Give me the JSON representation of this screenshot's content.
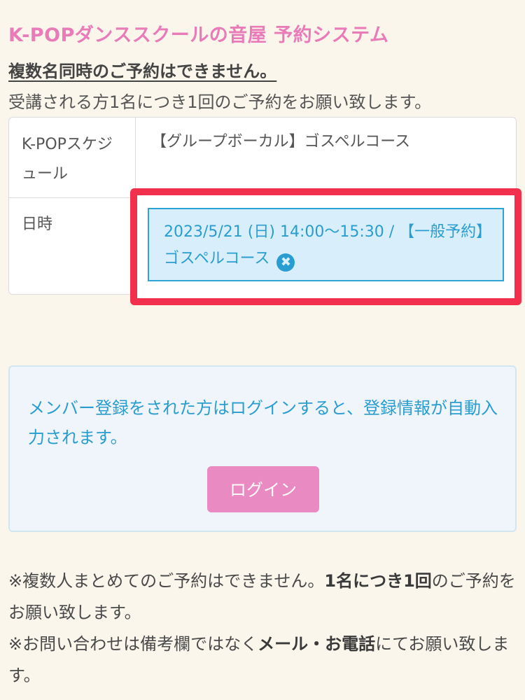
{
  "header": {
    "title": "K-POPダンススクールの音屋 予約システム",
    "notice_heading": "複数名同時のご予約はできません。",
    "notice_sub": "受講される方1名につき1回のご予約をお願い致します。"
  },
  "reservation_table": {
    "rows": [
      {
        "label": "K-POPスケジュール",
        "value": "【グループボーカル】ゴスペルコース"
      },
      {
        "label": "日時",
        "value": "2023/5/21 (日) 14:00～15:30 / 【一般予約】ゴスペルコース"
      }
    ],
    "remove_icon_glyph": "✖"
  },
  "login_panel": {
    "message": "メンバー登録をされた方はログインすると、登録情報が自動入力されます。",
    "button_label": "ログイン"
  },
  "footer": {
    "note1_prefix": "※複数人まとめてのご予約はできません。",
    "note1_bold": "1名につき1回",
    "note1_suffix": "のご予約をお願い致します。",
    "note2_prefix": "※お問い合わせは備考欄ではなく",
    "note2_bold": "メール・お電話",
    "note2_suffix": "にてお願い致します。"
  },
  "colors": {
    "title_pink": "#e87bb8",
    "accent_blue": "#2a9dd0",
    "highlight_red": "#f2304e",
    "login_button_pink": "#ea8ac2",
    "background": "#faf6ec"
  }
}
